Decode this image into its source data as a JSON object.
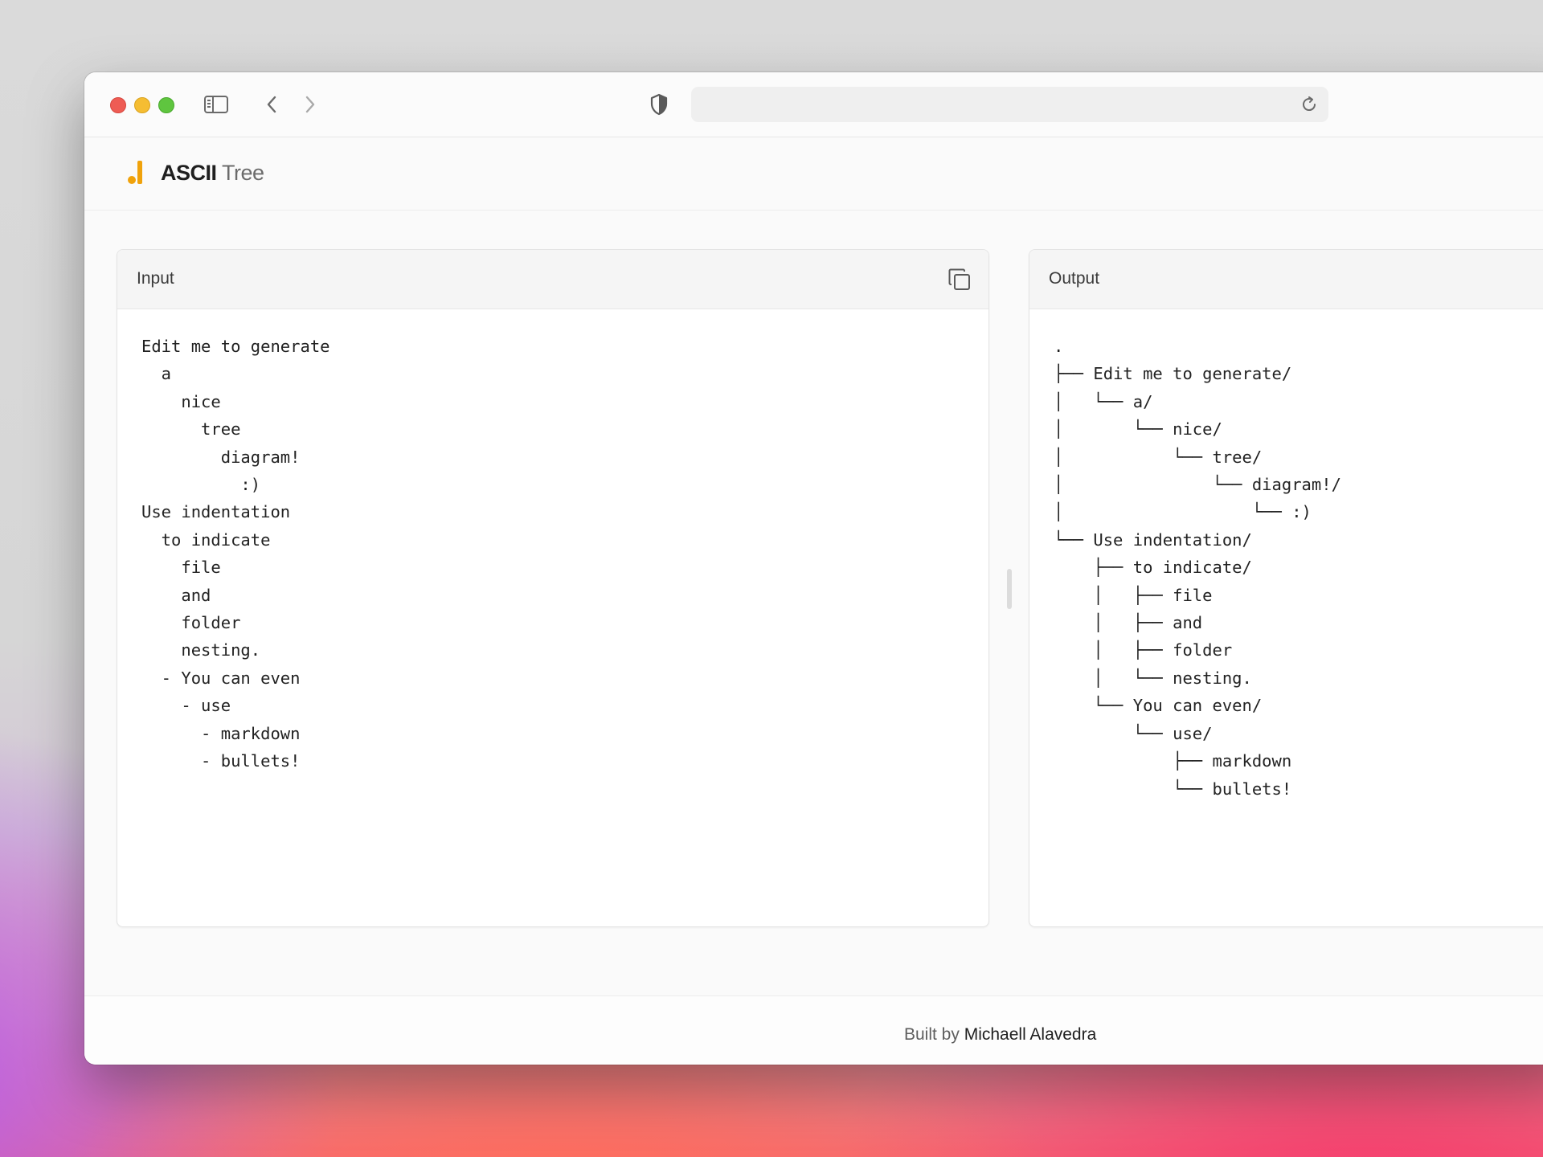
{
  "app": {
    "brand_strong": "ASCII",
    "brand_light": "Tree",
    "accent_color": "#f0a20b"
  },
  "toolbar": {
    "url": ""
  },
  "input_panel": {
    "title": "Input",
    "text": "Edit me to generate\n  a\n    nice\n      tree\n        diagram!\n          :)\nUse indentation\n  to indicate\n    file\n    and\n    folder\n    nesting.\n  - You can even\n    - use\n      - markdown\n      - bullets!"
  },
  "output_panel": {
    "title": "Output",
    "text": ".\n├── Edit me to generate/\n│   └── a/\n│       └── nice/\n│           └── tree/\n│               └── diagram!/\n│                   └── :)\n└── Use indentation/\n    ├── to indicate/\n    │   ├── file\n    │   ├── and\n    │   ├── folder\n    │   └── nesting.\n    └── You can even/\n        └── use/\n            ├── markdown\n            └── bullets!"
  },
  "footer": {
    "prefix": "Built by ",
    "author": "Michaell Alavedra"
  }
}
